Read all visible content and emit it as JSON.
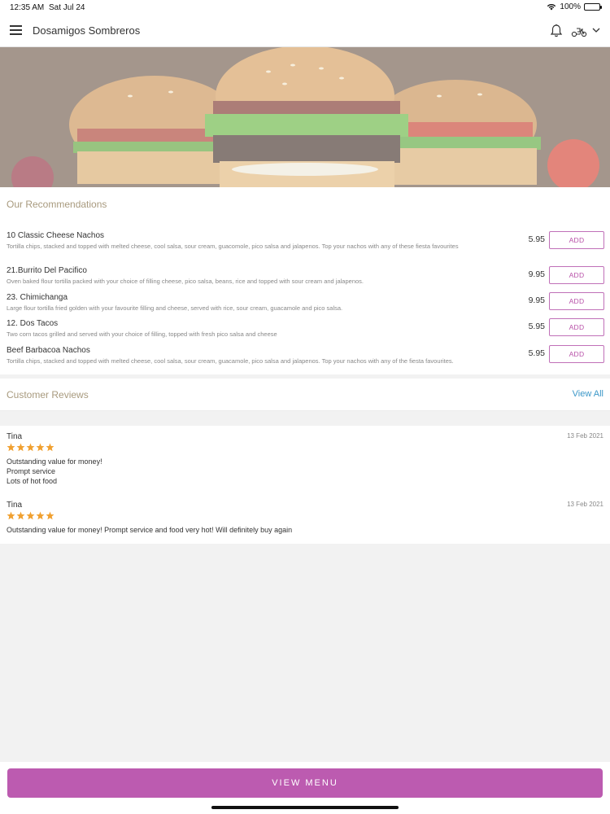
{
  "status_bar": {
    "time": "12:35 AM",
    "date": "Sat Jul 24",
    "battery": "100%"
  },
  "header": {
    "title": "Dosamigos Sombreros",
    "icons": [
      "menu-icon",
      "bell-icon",
      "scooter-icon",
      "chevron-down-icon"
    ]
  },
  "recommendations": {
    "title": "Our Recommendations",
    "add_label": "ADD",
    "items": [
      {
        "name": "10 Classic Cheese Nachos",
        "description": "Tortilla chips, stacked and topped with melted cheese, cool salsa, sour cream, guacomole, pico salsa and jalapenos. Top your nachos with any of these fiesta favourites",
        "price": "5.95"
      },
      {
        "name": "21.Burrito Del Pacifico",
        "description": "Oven baked flour tortilla packed with your choice of filling cheese, pico salsa, beans, rice and topped with sour cream and jalapenos.",
        "price": "9.95"
      },
      {
        "name": "23. Chimichanga",
        "description": "Large flour tortilla fried golden with your favourite filling and cheese, served with rice, sour cream, guacamole and pico salsa.",
        "price": "9.95"
      },
      {
        "name": "12. Dos Tacos",
        "description": "Two corn tacos grilled and served with your choice of filling, topped with fresh pico salsa and cheese",
        "price": "5.95"
      },
      {
        "name": "Beef Barbacoa Nachos",
        "description": "Tortilla chips, stacked and topped with melted cheese, cool salsa, sour cream, guacamole, pico salsa and jalapenos. Top your nachos with any of the fiesta favourites.",
        "price": "5.95"
      }
    ]
  },
  "reviews": {
    "title": "Customer Reviews",
    "view_all": "View All",
    "items": [
      {
        "name": "Tina",
        "date": "13 Feb 2021",
        "rating": 5,
        "lines": [
          "Outstanding value for money!",
          "Prompt service",
          "Lots of hot food"
        ]
      },
      {
        "name": "Tina",
        "date": "13 Feb 2021",
        "rating": 5,
        "lines": [
          "Outstanding value for money! Prompt service and food very hot! Will definitely buy again"
        ]
      }
    ]
  },
  "footer": {
    "view_menu": "VIEW MENU"
  },
  "colors": {
    "accent": "#bc5bb0",
    "link": "#3b97c8",
    "star": "#f0a030",
    "section_title": "#a89a7e"
  }
}
